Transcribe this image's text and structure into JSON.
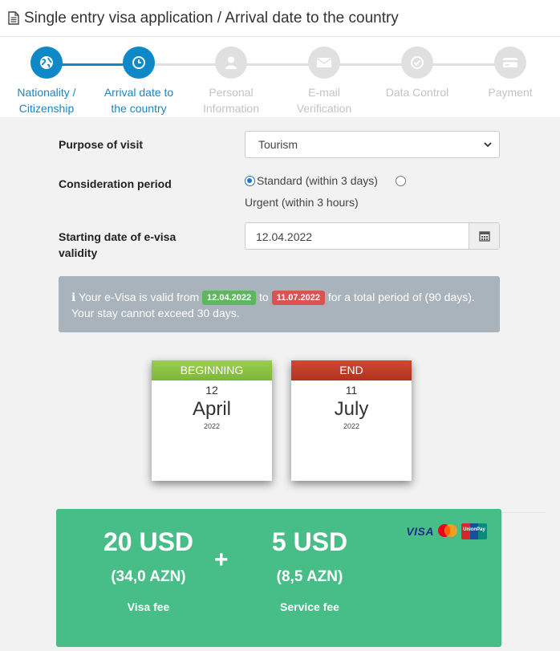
{
  "page_title": "Single entry visa application / Arrival date to the country",
  "steps": [
    {
      "label_1": "Nationality /",
      "label_2": "Citizenship",
      "state": "active",
      "icon": "globe-icon"
    },
    {
      "label_1": "Arrival date to",
      "label_2": "the country",
      "state": "active",
      "icon": "clock-icon"
    },
    {
      "label_1": "Personal",
      "label_2": "Information",
      "state": "inactive",
      "icon": "user-icon"
    },
    {
      "label_1": "E-mail",
      "label_2": "Verification",
      "state": "inactive",
      "icon": "envelope-icon"
    },
    {
      "label_1": "Data Control",
      "label_2": "",
      "state": "inactive",
      "icon": "check-circle-icon"
    },
    {
      "label_1": "Payment",
      "label_2": "",
      "state": "inactive",
      "icon": "credit-card-icon"
    }
  ],
  "form": {
    "purpose_label": "Purpose of visit",
    "purpose_value": "Tourism",
    "period_label": "Consideration period",
    "period_standard": "Standard (within 3 days)",
    "period_urgent": "Urgent (within 3 hours)",
    "start_label_1": "Starting date of e-visa",
    "start_label_2": "validity",
    "start_value": "12.04.2022"
  },
  "info": {
    "icon": "info-icon",
    "text_1": "Your e-Visa is valid from",
    "from_date": "12.04.2022",
    "text_2": "to",
    "to_date": "11.07.2022",
    "text_3": "for a total period of (90 days).",
    "text_4": "Your stay cannot exceed 30 days."
  },
  "begin_card": {
    "header": "BEGINNING",
    "day": "12",
    "month": "April",
    "year": "2022"
  },
  "end_card": {
    "header": "END",
    "day": "11",
    "month": "July",
    "year": "2022"
  },
  "fees": {
    "visa_amount": "20 USD",
    "visa_azn": "(34,0 AZN)",
    "visa_label": "Visa fee",
    "plus": "+",
    "service_amount": "5 USD",
    "service_azn": "(8,5 AZN)",
    "service_label": "Service fee",
    "visa_logo_text": "VISA",
    "unionpay_text": "UnionPay"
  },
  "colors": {
    "step_active": "#0e88c7",
    "step_inactive": "#e0e0e0",
    "badge_green": "#5cb85c",
    "badge_red": "#d9534f",
    "info_bg": "#a9b3bc",
    "fee_bg": "#47be87",
    "begin_band": "#8bc34a",
    "end_band": "#c0392b"
  }
}
